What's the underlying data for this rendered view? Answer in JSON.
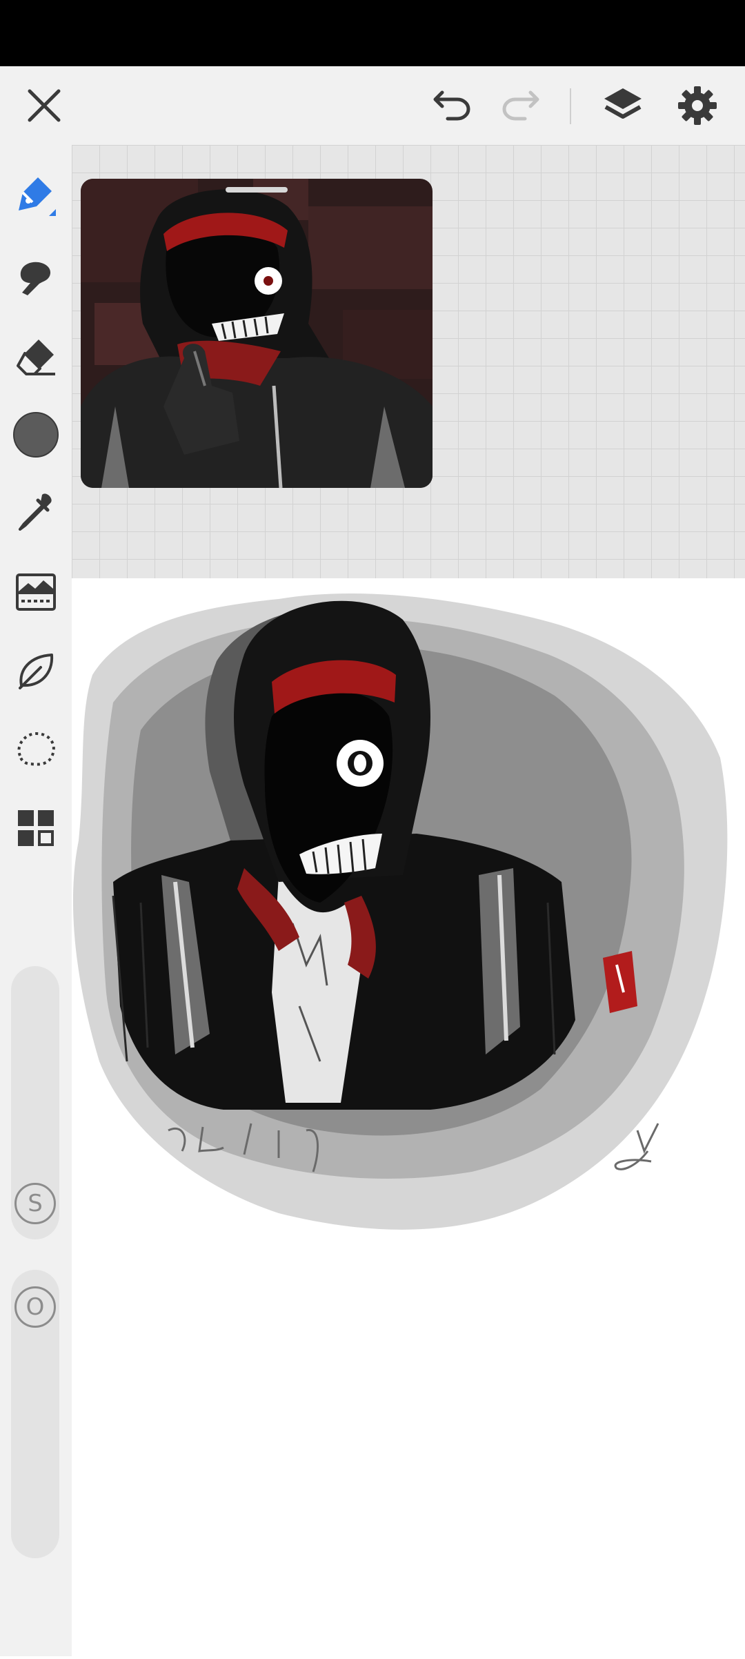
{
  "toolbar": {
    "close": "close-icon",
    "undo": "undo-icon",
    "redo": "redo-icon",
    "layers": "layers-icon",
    "settings": "gear-icon"
  },
  "tools": [
    {
      "name": "pen",
      "icon": "pen-icon",
      "active": true
    },
    {
      "name": "smudge",
      "icon": "smudge-icon"
    },
    {
      "name": "eraser",
      "icon": "eraser-icon"
    },
    {
      "name": "color",
      "icon": "color-swatch",
      "color": "#5b5b5b"
    },
    {
      "name": "eyedropper",
      "icon": "eyedropper-icon"
    },
    {
      "name": "image",
      "icon": "image-icon"
    },
    {
      "name": "leaf",
      "icon": "leaf-icon"
    },
    {
      "name": "lasso",
      "icon": "lasso-icon"
    },
    {
      "name": "more",
      "icon": "grid-icon"
    }
  ],
  "sliders": {
    "size_label": "S",
    "opacity_label": "O"
  },
  "colors": {
    "accent": "#2f7be6",
    "icon": "#3a3a3a",
    "disabled": "#c2c2c2",
    "brush_red": "#a01818"
  },
  "artwork": {
    "signature_date": "425.11.9",
    "signature_initial": "y"
  }
}
